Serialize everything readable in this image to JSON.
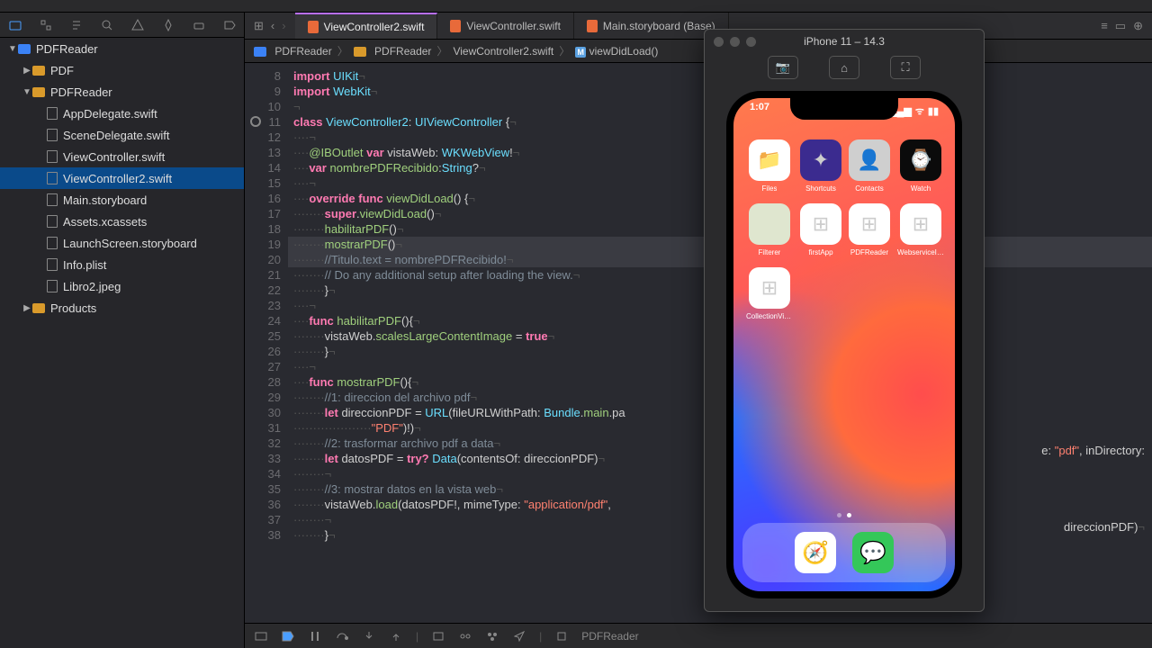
{
  "tabs": [
    {
      "label": "ViewController2.swift",
      "active": true
    },
    {
      "label": "ViewController.swift",
      "active": false
    },
    {
      "label": "Main.storyboard (Base)",
      "active": false
    }
  ],
  "breadcrumb": [
    "PDFReader",
    "PDFReader",
    "ViewController2.swift",
    "viewDidLoad()"
  ],
  "nav": [
    {
      "depth": 0,
      "kind": "proj",
      "label": "PDFReader",
      "disclosure": "down"
    },
    {
      "depth": 1,
      "kind": "folder",
      "label": "PDF",
      "disclosure": "right"
    },
    {
      "depth": 1,
      "kind": "folder",
      "label": "PDFReader",
      "disclosure": "down"
    },
    {
      "depth": 2,
      "kind": "swift",
      "label": "AppDelegate.swift"
    },
    {
      "depth": 2,
      "kind": "swift",
      "label": "SceneDelegate.swift"
    },
    {
      "depth": 2,
      "kind": "swift",
      "label": "ViewController.swift"
    },
    {
      "depth": 2,
      "kind": "swift",
      "label": "ViewController2.swift",
      "selected": true
    },
    {
      "depth": 2,
      "kind": "sb",
      "label": "Main.storyboard"
    },
    {
      "depth": 2,
      "kind": "assets",
      "label": "Assets.xcassets"
    },
    {
      "depth": 2,
      "kind": "sb",
      "label": "LaunchScreen.storyboard"
    },
    {
      "depth": 2,
      "kind": "plist",
      "label": "Info.plist"
    },
    {
      "depth": 2,
      "kind": "img",
      "label": "Libro2.jpeg"
    },
    {
      "depth": 1,
      "kind": "folder",
      "label": "Products",
      "disclosure": "right"
    }
  ],
  "code": {
    "start": 8,
    "highlight": [
      19,
      20
    ],
    "gutter_mark": 11,
    "lines": [
      [
        [
          "kw",
          "import"
        ],
        [
          "sp",
          " "
        ],
        [
          "type",
          "UIKit"
        ],
        [
          "inv",
          "¬"
        ]
      ],
      [
        [
          "kw",
          "import"
        ],
        [
          "sp",
          " "
        ],
        [
          "type",
          "WebKit"
        ],
        [
          "inv",
          "¬"
        ]
      ],
      [
        [
          "inv",
          "¬"
        ]
      ],
      [
        [
          "kw",
          "class"
        ],
        [
          "sp",
          " "
        ],
        [
          "type",
          "ViewController2"
        ],
        [
          "punct",
          ": "
        ],
        [
          "type",
          "UIViewController"
        ],
        [
          "punct",
          " {"
        ],
        [
          "inv",
          "¬"
        ]
      ],
      [
        [
          "inv",
          "····"
        ],
        [
          "inv",
          "¬"
        ]
      ],
      [
        [
          "inv",
          "····"
        ],
        [
          "fn",
          "@IBOutlet"
        ],
        [
          "sp",
          " "
        ],
        [
          "kw",
          "var"
        ],
        [
          "sp",
          " "
        ],
        [
          "punct",
          "vistaWeb"
        ],
        [
          "punct",
          ": "
        ],
        [
          "type",
          "WKWebView"
        ],
        [
          "punct",
          "!"
        ],
        [
          "inv",
          "¬"
        ]
      ],
      [
        [
          "inv",
          "····"
        ],
        [
          "kw",
          "var"
        ],
        [
          "sp",
          " "
        ],
        [
          "fn",
          "nombrePDFRecibido"
        ],
        [
          "punct",
          ":"
        ],
        [
          "type",
          "String"
        ],
        [
          "punct",
          "?"
        ],
        [
          "inv",
          "¬"
        ]
      ],
      [
        [
          "inv",
          "····"
        ],
        [
          "inv",
          "¬"
        ]
      ],
      [
        [
          "inv",
          "····"
        ],
        [
          "kw",
          "override"
        ],
        [
          "sp",
          " "
        ],
        [
          "kw",
          "func"
        ],
        [
          "sp",
          " "
        ],
        [
          "fn",
          "viewDidLoad"
        ],
        [
          "punct",
          "() {"
        ],
        [
          "inv",
          "¬"
        ]
      ],
      [
        [
          "inv",
          "········"
        ],
        [
          "kw",
          "super"
        ],
        [
          "punct",
          "."
        ],
        [
          "fn",
          "viewDidLoad"
        ],
        [
          "punct",
          "()"
        ],
        [
          "inv",
          "¬"
        ]
      ],
      [
        [
          "inv",
          "········"
        ],
        [
          "fn",
          "habilitarPDF"
        ],
        [
          "punct",
          "()"
        ],
        [
          "inv",
          "¬"
        ]
      ],
      [
        [
          "inv",
          "········"
        ],
        [
          "fn",
          "mostrarPDF"
        ],
        [
          "punct",
          "()"
        ],
        [
          "inv",
          "¬"
        ]
      ],
      [
        [
          "inv",
          "········"
        ],
        [
          "cm",
          "//Titulo.text = nombrePDFRecibido!"
        ],
        [
          "inv",
          "¬"
        ]
      ],
      [
        [
          "inv",
          "········"
        ],
        [
          "cm",
          "// Do any additional setup after loading the view."
        ],
        [
          "inv",
          "¬"
        ]
      ],
      [
        [
          "inv",
          "········"
        ],
        [
          "punct",
          "}"
        ],
        [
          "inv",
          "¬"
        ]
      ],
      [
        [
          "inv",
          "····"
        ],
        [
          "inv",
          "¬"
        ]
      ],
      [
        [
          "inv",
          "····"
        ],
        [
          "kw",
          "func"
        ],
        [
          "sp",
          " "
        ],
        [
          "fn",
          "habilitarPDF"
        ],
        [
          "punct",
          "(){"
        ],
        [
          "inv",
          "¬"
        ]
      ],
      [
        [
          "inv",
          "········"
        ],
        [
          "punct",
          "vistaWeb."
        ],
        [
          "fn",
          "scalesLargeContentImage"
        ],
        [
          "punct",
          " = "
        ],
        [
          "kw",
          "true"
        ],
        [
          "inv",
          "¬"
        ]
      ],
      [
        [
          "inv",
          "········"
        ],
        [
          "punct",
          "}"
        ],
        [
          "inv",
          "¬"
        ]
      ],
      [
        [
          "inv",
          "····"
        ],
        [
          "inv",
          "¬"
        ]
      ],
      [
        [
          "inv",
          "····"
        ],
        [
          "kw",
          "func"
        ],
        [
          "sp",
          " "
        ],
        [
          "fn",
          "mostrarPDF"
        ],
        [
          "punct",
          "(){"
        ],
        [
          "inv",
          "¬"
        ]
      ],
      [
        [
          "inv",
          "········"
        ],
        [
          "cm",
          "//1: direccion del archivo pdf"
        ],
        [
          "inv",
          "¬"
        ]
      ],
      [
        [
          "inv",
          "········"
        ],
        [
          "kw",
          "let"
        ],
        [
          "sp",
          " "
        ],
        [
          "punct",
          "direccionPDF = "
        ],
        [
          "type",
          "URL"
        ],
        [
          "punct",
          "(fileURLWithPath: "
        ],
        [
          "type",
          "Bundle"
        ],
        [
          "punct",
          "."
        ],
        [
          "fn",
          "main"
        ],
        [
          "punct",
          ".pa"
        ]
      ],
      [
        [
          "inv",
          "····················"
        ],
        [
          "str",
          "\"PDF\""
        ],
        [
          "punct",
          ")!)"
        ],
        [
          "inv",
          "¬"
        ]
      ],
      [
        [
          "inv",
          "········"
        ],
        [
          "cm",
          "//2: trasformar archivo pdf a data"
        ],
        [
          "inv",
          "¬"
        ]
      ],
      [
        [
          "inv",
          "········"
        ],
        [
          "kw",
          "let"
        ],
        [
          "sp",
          " "
        ],
        [
          "punct",
          "datosPDF = "
        ],
        [
          "kw",
          "try?"
        ],
        [
          "sp",
          " "
        ],
        [
          "type",
          "Data"
        ],
        [
          "punct",
          "(contentsOf: direccionPDF)"
        ],
        [
          "inv",
          "¬"
        ]
      ],
      [
        [
          "inv",
          "········"
        ],
        [
          "inv",
          "¬"
        ]
      ],
      [
        [
          "inv",
          "········"
        ],
        [
          "cm",
          "//3: mostrar datos en la vista web"
        ],
        [
          "inv",
          "¬"
        ]
      ],
      [
        [
          "inv",
          "········"
        ],
        [
          "punct",
          "vistaWeb."
        ],
        [
          "fn",
          "load"
        ],
        [
          "punct",
          "(datosPDF!, mimeType: "
        ],
        [
          "str",
          "\"application/pdf\""
        ],
        [
          "punct",
          ","
        ]
      ],
      [
        [
          "inv",
          "········"
        ],
        [
          "inv",
          "¬"
        ]
      ],
      [
        [
          "inv",
          "········"
        ],
        [
          "punct",
          "}"
        ],
        [
          "inv",
          "¬"
        ]
      ]
    ]
  },
  "right_snippets": [
    {
      "line": 30,
      "tokens": [
        [
          "punct",
          "e: "
        ],
        [
          "str",
          "\"pdf\""
        ],
        [
          "punct",
          ", inDirectory:"
        ]
      ]
    },
    {
      "line": 35,
      "tokens": [
        [
          "punct",
          "direccionPDF)"
        ],
        [
          "inv",
          "¬"
        ]
      ]
    }
  ],
  "debug": {
    "target": "PDFReader"
  },
  "simulator": {
    "title": "iPhone 11 – 14.3",
    "time": "1:07",
    "apps": [
      {
        "label": "Files",
        "color": "#ffffff",
        "emoji": "📁"
      },
      {
        "label": "Shortcuts",
        "color": "#3b2b8f",
        "emoji": "✦"
      },
      {
        "label": "Contacts",
        "color": "#cfcfcf",
        "emoji": "👤"
      },
      {
        "label": "Watch",
        "color": "#0b0b0b",
        "emoji": "⌚"
      },
      {
        "label": "Filterer",
        "color": "#dfe6cf",
        "emoji": ""
      },
      {
        "label": "firstApp",
        "color": "#ffffff",
        "emoji": "⊞"
      },
      {
        "label": "PDFReader",
        "color": "#ffffff",
        "emoji": "⊞"
      },
      {
        "label": "WebserviceIOS",
        "color": "#ffffff",
        "emoji": "⊞"
      },
      {
        "label": "CollectionView...",
        "color": "#ffffff",
        "emoji": "⊞"
      }
    ],
    "dock": [
      {
        "label": "Safari",
        "color": "#ffffff",
        "emoji": "🧭"
      },
      {
        "label": "Messages",
        "color": "#34c759",
        "emoji": "💬"
      }
    ]
  }
}
